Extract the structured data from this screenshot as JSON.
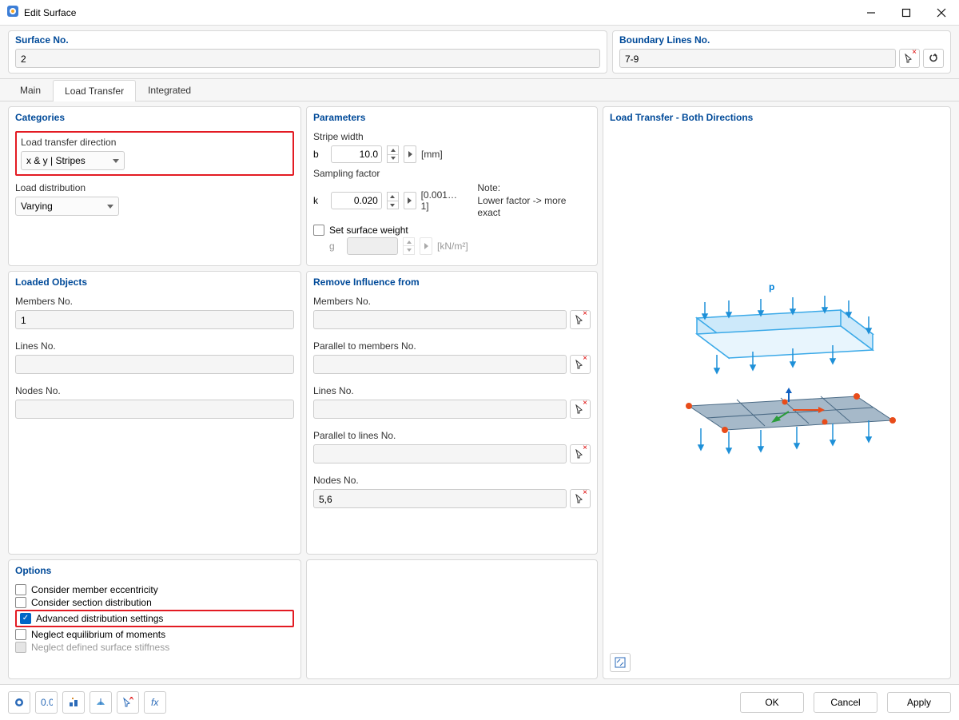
{
  "window": {
    "title": "Edit Surface"
  },
  "top": {
    "surface_no_label": "Surface No.",
    "surface_no_value": "2",
    "boundary_label": "Boundary Lines No.",
    "boundary_value": "7-9"
  },
  "tabs": {
    "main": "Main",
    "load_transfer": "Load Transfer",
    "integrated": "Integrated"
  },
  "categories": {
    "title": "Categories",
    "load_dir_label": "Load transfer direction",
    "load_dir_value": "x & y | Stripes",
    "load_dist_label": "Load distribution",
    "load_dist_value": "Varying"
  },
  "parameters": {
    "title": "Parameters",
    "stripe_label": "Stripe width",
    "stripe_sym": "b",
    "stripe_val": "10.0",
    "stripe_unit": "[mm]",
    "sampling_label": "Sampling factor",
    "sampling_sym": "k",
    "sampling_val": "0.020",
    "sampling_range": "[0.001…1]",
    "note_head": "Note:",
    "note_body": "Lower factor -> more exact",
    "set_weight_label": "Set surface weight",
    "g_sym": "g",
    "g_unit": "[kN/m²]"
  },
  "loaded": {
    "title": "Loaded Objects",
    "members_label": "Members No.",
    "members_value": "1",
    "lines_label": "Lines No.",
    "lines_value": "",
    "nodes_label": "Nodes No.",
    "nodes_value": ""
  },
  "remove": {
    "title": "Remove Influence from",
    "members_label": "Members No.",
    "par_members_label": "Parallel to members No.",
    "lines_label": "Lines No.",
    "par_lines_label": "Parallel to lines No.",
    "nodes_label": "Nodes No.",
    "nodes_value": "5,6"
  },
  "options": {
    "title": "Options",
    "opt1": "Consider member eccentricity",
    "opt2": "Consider section distribution",
    "opt3": "Advanced distribution settings",
    "opt4": "Neglect equilibrium of moments",
    "opt5": "Neglect defined surface stiffness"
  },
  "preview": {
    "title": "Load Transfer - Both Directions",
    "p_label": "p"
  },
  "buttons": {
    "ok": "OK",
    "cancel": "Cancel",
    "apply": "Apply"
  }
}
